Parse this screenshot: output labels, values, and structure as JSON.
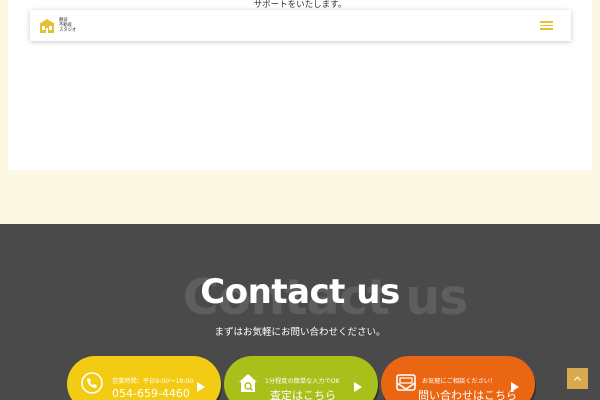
{
  "intro": {
    "text": "サポートをいたします。"
  },
  "header": {
    "logo_lines": [
      "静波",
      "不動産",
      "スタジオ"
    ],
    "logo_icon": "house-icon",
    "menu_icon": "hamburger-menu-icon"
  },
  "contact": {
    "bg_text": "Contact us",
    "title": "Contact us",
    "subtitle": "まずはお気軽にお問い合わせください。"
  },
  "cta": {
    "phone": {
      "small": "営業時間：平日9:00～18:00",
      "big": "054-659-4460",
      "icon": "phone-icon",
      "color": "#f3cb12"
    },
    "assess": {
      "small": "1分程度の簡単な入力でOK",
      "big": "査定はこちら",
      "icon": "home-search-icon",
      "color": "#a9c01a"
    },
    "inquiry": {
      "small": "お気軽にご相談ください！",
      "big": "問い合わせはこちら",
      "icon": "mail-icon",
      "color": "#ea6612"
    }
  },
  "page_top": {
    "icon": "arrow-up-icon"
  },
  "colors": {
    "cream_bg": "#fcf8e2",
    "dark_bg": "#4a4a4a",
    "accent_gold": "#e6bf33",
    "page_top": "#d9a950"
  }
}
